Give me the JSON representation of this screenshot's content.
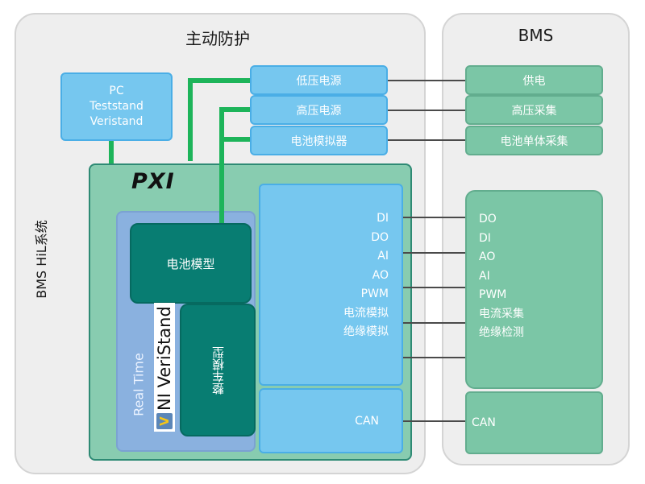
{
  "system_label": "BMS HiL系统",
  "left_panel": {
    "title": "主动防护",
    "pc_box": [
      "PC",
      "Teststand",
      "Veristand"
    ],
    "power_boxes": [
      "低压电源",
      "高压电源",
      "电池模拟器"
    ],
    "pxi": {
      "logo": "PXI",
      "realtime_label": "Real Time",
      "veristand_label": "NI VeriStand",
      "veristand_icon": "V",
      "battery_model": "电池模型",
      "vehicle_model": "整车模型",
      "io_signals": [
        "DI",
        "DO",
        "AI",
        "AO",
        "PWM",
        "电流模拟",
        "绝缘模拟"
      ],
      "can_label": "CAN"
    }
  },
  "bms_panel": {
    "title": "BMS",
    "power_boxes": [
      "供电",
      "高压采集",
      "电池单体采集"
    ],
    "io_signals": [
      "DO",
      "DI",
      "AO",
      "AI",
      "PWM",
      "电流采集",
      "绝缘检测"
    ],
    "can_label": "CAN"
  },
  "colors": {
    "blue_box": "#76c7ef",
    "green_box": "#7bc6a6",
    "pxi_bg": "#88ccb0",
    "dark_teal": "#087d72",
    "green_wire": "#1db45a"
  }
}
